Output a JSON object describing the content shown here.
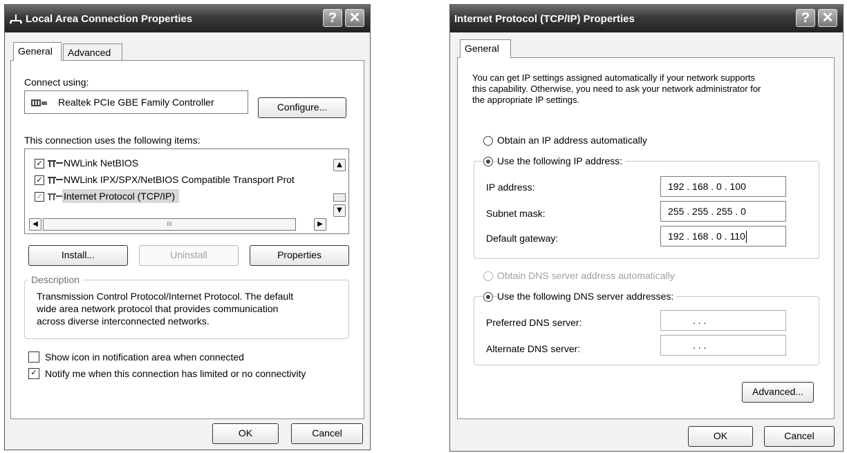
{
  "lan_dialog": {
    "title": "Local Area Connection Properties",
    "help_label": "?",
    "close_label": "✕",
    "tabs": [
      {
        "label": "General"
      },
      {
        "label": "Advanced"
      }
    ],
    "connect_using_label": "Connect using:",
    "adapter_name": "Realtek PCIe GBE Family Controller",
    "configure_label": "Configure...",
    "items_label": "This connection uses the following items:",
    "items": [
      {
        "label": "NWLink NetBIOS",
        "checked": true
      },
      {
        "label": "NWLink IPX/SPX/NetBIOS Compatible Transport Prot",
        "checked": true
      },
      {
        "label": "Internet Protocol (TCP/IP)",
        "checked": true,
        "selected": true
      }
    ],
    "scroll_up": "▲",
    "scroll_down": "▼",
    "scroll_left": "◀",
    "scroll_right": "▶",
    "hscroll_grip": "III",
    "install_label": "Install...",
    "uninstall_label": "Uninstall",
    "properties_label": "Properties",
    "description_legend": "Description",
    "description_text": [
      "Transmission Control Protocol/Internet Protocol. The default",
      "wide area network protocol that provides communication",
      "across diverse interconnected networks."
    ],
    "show_icon_label": "Show icon in notification area when connected",
    "show_icon_checked": false,
    "notify_label": "Notify me when this connection has limited or no connectivity",
    "notify_checked": true,
    "check_mark": "✓",
    "ok_label": "OK",
    "cancel_label": "Cancel"
  },
  "tcpip_dialog": {
    "title": "Internet Protocol (TCP/IP) Properties",
    "help_label": "?",
    "close_label": "✕",
    "tabs": [
      {
        "label": "General"
      }
    ],
    "intro_lines": [
      "You can get IP settings assigned automatically if your network supports",
      "this capability. Otherwise, you need to ask your network administrator for",
      "the appropriate IP settings."
    ],
    "obtain_ip_auto_label": "Obtain an IP address automatically",
    "use_ip_label": "Use the following IP address:",
    "ip_address_label": "IP address:",
    "ip_address_value": "192 . 168 .  0  . 100",
    "subnet_label": "Subnet mask:",
    "subnet_value": "255 . 255 . 255 .  0",
    "gateway_label": "Default gateway:",
    "gateway_value": "192 . 168 .  0  . 110",
    "obtain_dns_auto_label": "Obtain DNS server address automatically",
    "use_dns_label": "Use the following DNS server addresses:",
    "preferred_dns_label": "Preferred DNS server:",
    "preferred_dns_value": ".     .     .",
    "alternate_dns_label": "Alternate DNS server:",
    "alternate_dns_value": ".     .     .",
    "advanced_label": "Advanced...",
    "ok_label": "OK",
    "cancel_label": "Cancel"
  }
}
